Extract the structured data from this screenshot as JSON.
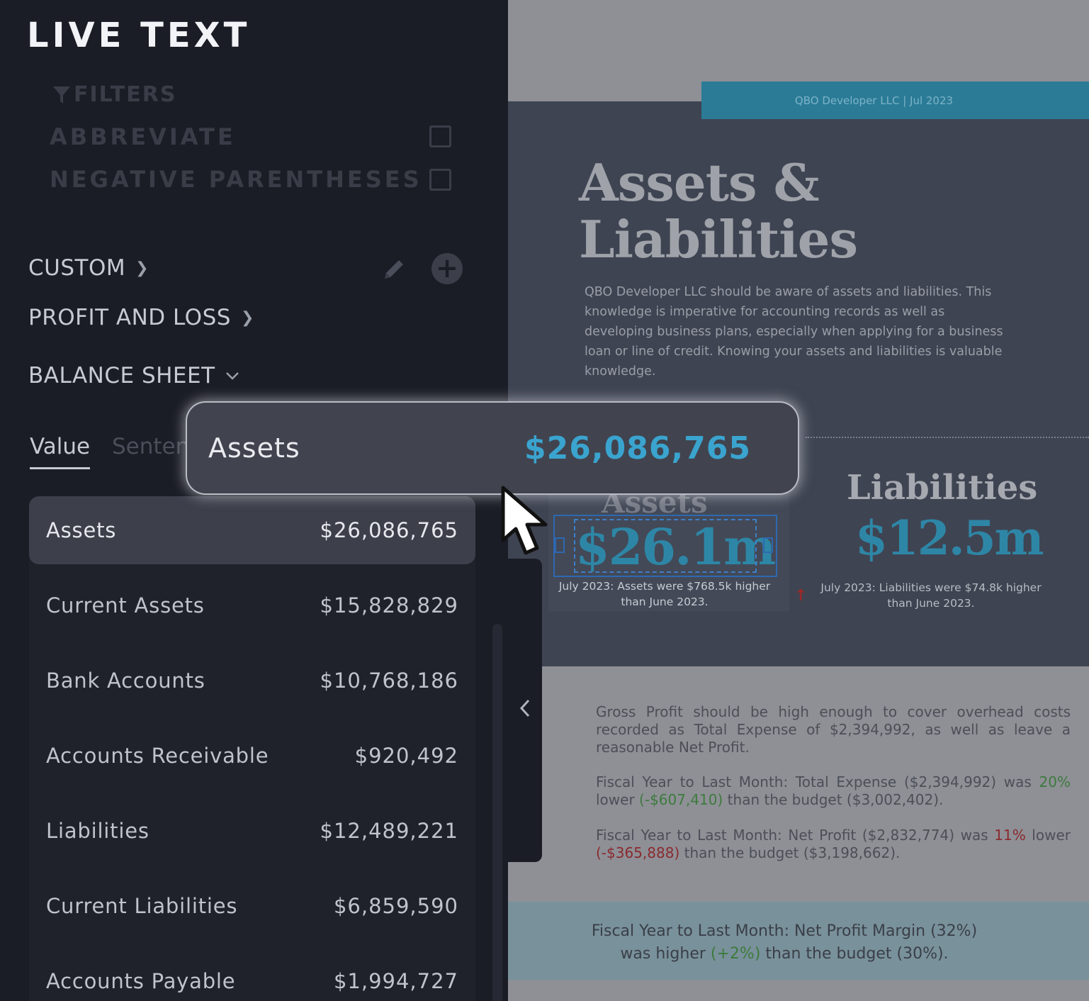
{
  "panel": {
    "title": "LIVE TEXT",
    "filters_label": "FILTERS",
    "options": [
      {
        "label": "ABBREVIATE",
        "checked": false
      },
      {
        "label": "NEGATIVE PARENTHESES",
        "checked": false
      }
    ],
    "sections": [
      {
        "label": "CUSTOM",
        "expanded": false
      },
      {
        "label": "PROFIT AND LOSS",
        "expanded": false
      },
      {
        "label": "BALANCE SHEET",
        "expanded": true
      }
    ],
    "tabs": [
      {
        "label": "Value",
        "active": true
      },
      {
        "label": "Senten",
        "active": false
      }
    ],
    "rows": [
      {
        "label": "Assets",
        "value": "$26,086,765",
        "selected": true
      },
      {
        "label": "Current Assets",
        "value": "$15,828,829",
        "selected": false
      },
      {
        "label": "Bank Accounts",
        "value": "$10,768,186",
        "selected": false
      },
      {
        "label": "Accounts Receivable",
        "value": "$920,492",
        "selected": false
      },
      {
        "label": "Liabilities",
        "value": "$12,489,221",
        "selected": false
      },
      {
        "label": "Current Liabilities",
        "value": "$6,859,590",
        "selected": false
      },
      {
        "label": "Accounts Payable",
        "value": "$1,994,727",
        "selected": false
      }
    ]
  },
  "tooltip": {
    "label": "Assets",
    "value": "$26,086,765"
  },
  "document": {
    "banner": "QBO Developer LLC |  Jul 2023",
    "title_line1": "Assets &",
    "title_line2": "Liabilities",
    "intro": "QBO Developer LLC should be aware of assets and liabilities. This knowledge is imperative for accounting records as well as developing business plans, especially when applying for a business loan or line of credit.  Knowing your assets and liabilities is valuable knowledge.",
    "assets": {
      "heading": "Assets",
      "value": "$26.1m",
      "caption": "July 2023: Assets were $768.5k higher than June 2023."
    },
    "liabilities": {
      "heading": "Liabilities",
      "value": "$12.5m",
      "caption": "July 2023: Liabilities were $74.8k higher than June 2023."
    },
    "para1": "Gross Profit should be high enough to cover overhead costs recorded as Total Expense of $2,394,992, as well as leave a reasonable Net Profit.",
    "para2": {
      "a": "Fiscal Year to Last Month: Total Expense ($2,394,992) was ",
      "pct": "20%",
      "b": " lower ",
      "delta": "(-$607,410)",
      "c": " than the budget ($3,002,402)."
    },
    "para3": {
      "a": "Fiscal Year to Last Month: Net Profit ($2,832,774) was ",
      "pct": "11%",
      "b": " lower ",
      "delta": "(-$365,888)",
      "c": " than the budget ($3,198,662)."
    },
    "bottom": {
      "a": "Fiscal Year to Last Month: Net Profit Margin (32%) was higher ",
      "delta": "(+2%)",
      "c": " than the budget (30%)."
    }
  },
  "colors": {
    "accent": "#3aa4cf",
    "banner": "#2b7b97",
    "panel_bg": "#1b1d26",
    "selected_row": "#3d404b",
    "positive": "#3d7a3d",
    "negative": "#8a2a2e"
  }
}
